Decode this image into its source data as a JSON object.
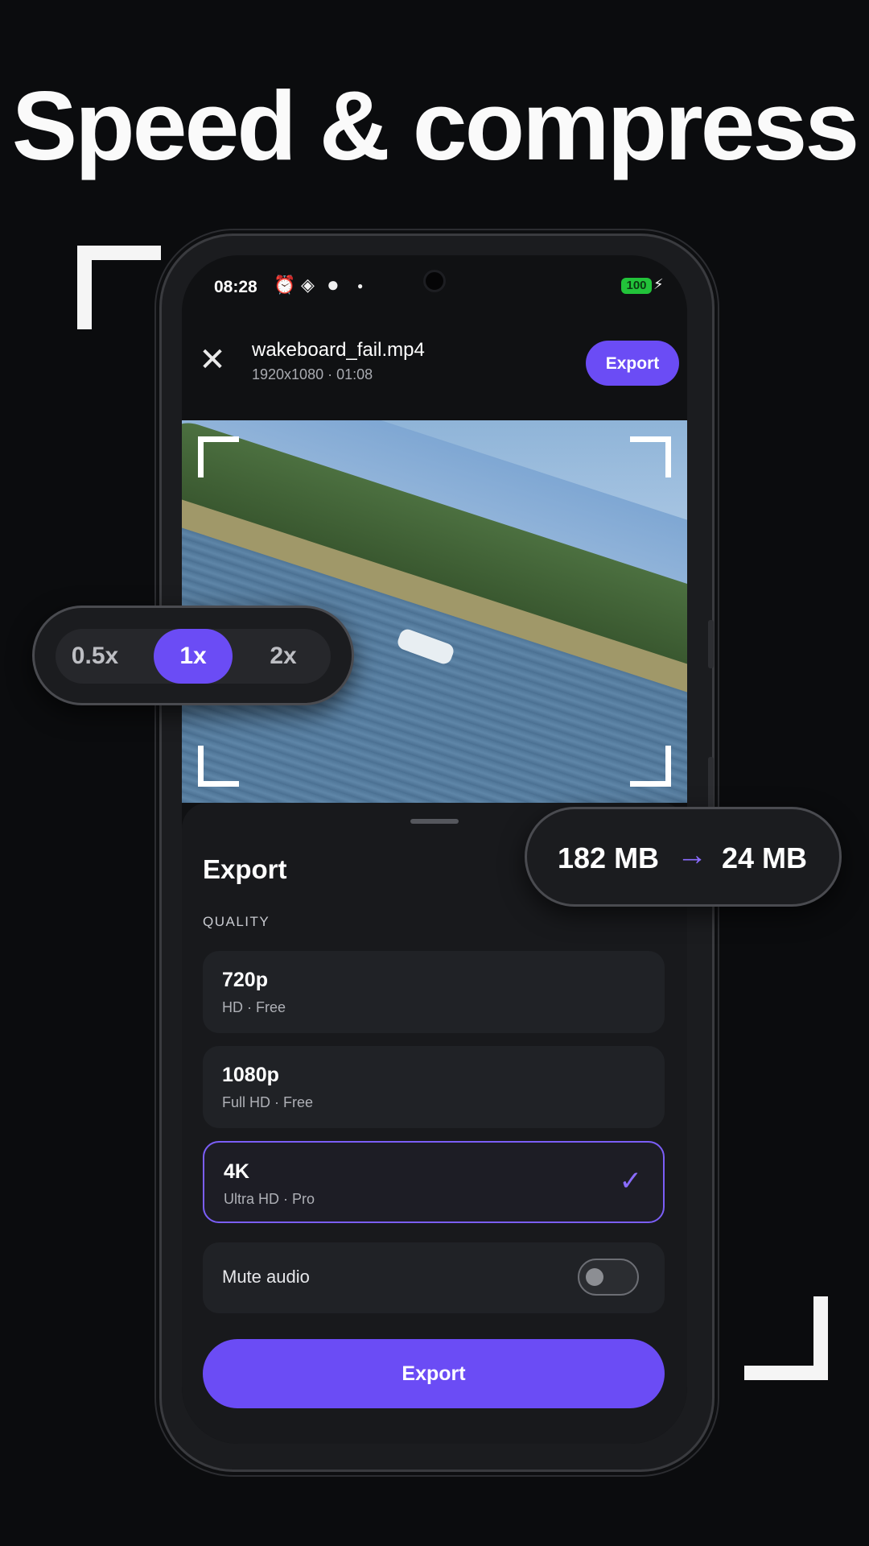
{
  "headline": "Speed & compress",
  "status": {
    "time": "08:28",
    "battery": "100",
    "icons": [
      "alarm-icon",
      "location-icon",
      "circle-icon",
      "dot-icon",
      "charging-icon"
    ]
  },
  "editor": {
    "close_icon": "close-icon",
    "file_name": "wakeboard_fail.mp4",
    "file_meta": "1920x1080 · 01:08",
    "export_label": "Export"
  },
  "speed": {
    "options": [
      "0.5x",
      "1x",
      "2x"
    ],
    "selected": "1x"
  },
  "size": {
    "from": "182 MB",
    "to": "24 MB",
    "arrow_icon": "arrow-right-icon"
  },
  "sheet": {
    "title": "Export",
    "quality_label": "QUALITY",
    "options": [
      {
        "title": "720p",
        "subtitle": "HD · Free",
        "selected": false
      },
      {
        "title": "1080p",
        "subtitle": "Full HD · Free",
        "selected": false
      },
      {
        "title": "4K",
        "subtitle": "Ultra HD · Pro",
        "selected": true
      }
    ],
    "mute_label": "Mute audio",
    "mute_on": false,
    "export_button": "Export"
  },
  "colors": {
    "accent": "#6b4cf5",
    "background": "#0b0c0e",
    "battery": "#22c33a"
  }
}
